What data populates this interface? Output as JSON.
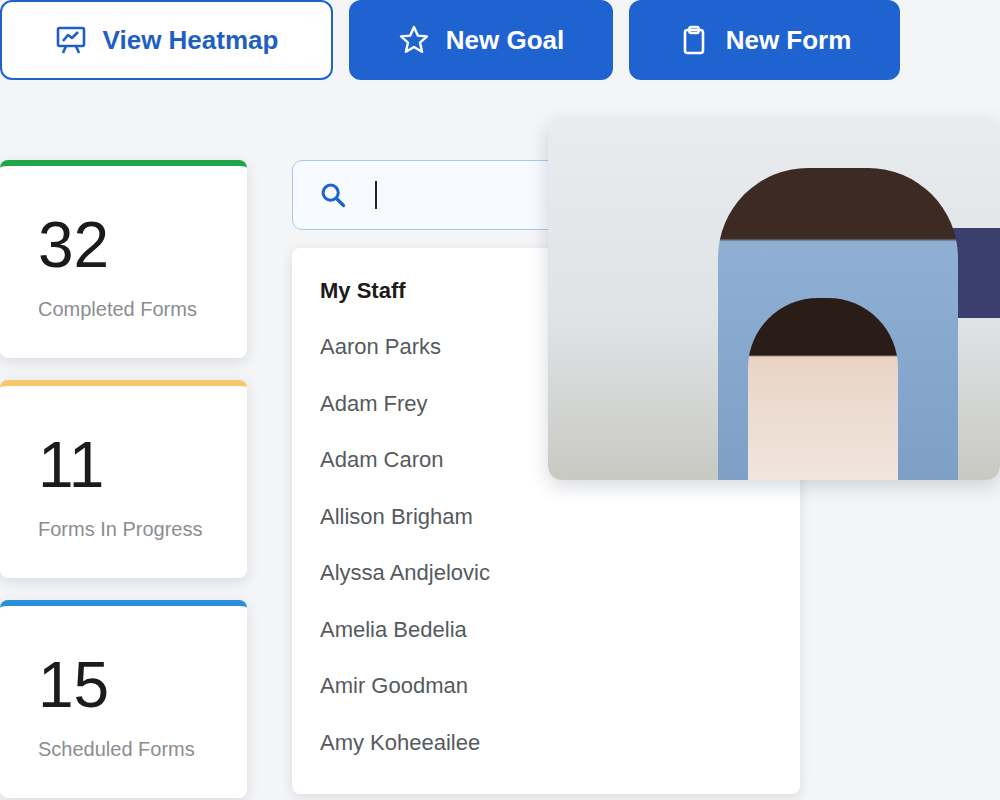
{
  "toolbar": {
    "buttons": [
      {
        "label": "View Heatmap",
        "kind": "outline"
      },
      {
        "label": "New Goal",
        "kind": "filled"
      },
      {
        "label": "New Form",
        "kind": "filled"
      }
    ]
  },
  "stats": [
    {
      "value": "32",
      "label": "Completed Forms",
      "color": "#1fa64a"
    },
    {
      "value": "11",
      "label": "Forms In Progress",
      "color": "#f7c76c"
    },
    {
      "value": "15",
      "label": "Scheduled Forms",
      "color": "#2a8fd6"
    }
  ],
  "search": {
    "value": "",
    "focused": true
  },
  "dropdown": {
    "heading": "My Staff",
    "items": [
      "Aaron Parks",
      "Adam Frey",
      "Adam Caron",
      "Allison Brigham",
      "Alyssa Andjelovic",
      "Amelia Bedelia",
      "Amir Goodman",
      "Amy Koheeailee"
    ]
  }
}
